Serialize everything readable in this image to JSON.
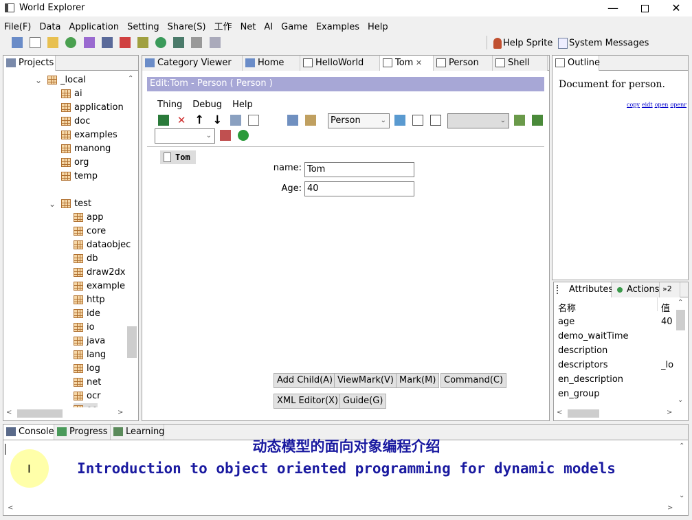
{
  "window": {
    "title": "World Explorer"
  },
  "menu": [
    "File(F)",
    "Data",
    "Application",
    "Setting",
    "Share(S)",
    "工作",
    "Net",
    "AI",
    "Game",
    "Examples",
    "Help"
  ],
  "toolbar_right": {
    "help_sprite": "Help Sprite",
    "system_messages": "System Messages"
  },
  "projects": {
    "tab": "Projects",
    "root": "_local",
    "items": [
      "ai",
      "application",
      "doc",
      "examples",
      "manong",
      "org",
      "temp"
    ],
    "test": "test",
    "test_items": [
      "app",
      "core",
      "dataobjec",
      "db",
      "draw2dx",
      "example",
      "http",
      "ide",
      "io",
      "java",
      "lang",
      "log",
      "net",
      "ocr",
      "oo"
    ]
  },
  "editor_tabs": [
    "Category Viewer",
    "Home",
    "HelloWorld",
    "Tom",
    "Person",
    "Shell"
  ],
  "editor": {
    "header": "Edit:Tom - Person ( Person )",
    "menus": [
      "Thing",
      "Debug",
      "Help"
    ],
    "combo_person": "Person",
    "node": "Tom",
    "fields": [
      {
        "label": "name:",
        "value": "Tom"
      },
      {
        "label": "Age:",
        "value": "40"
      }
    ],
    "buttons_row1": [
      "Add Child(A)",
      "ViewMark(V)",
      "Mark(M)",
      "Command(C)"
    ],
    "buttons_row2": [
      "XML Editor(X)",
      "Guide(G)"
    ]
  },
  "outline": {
    "tab": "Outline",
    "text": "Document for person.",
    "links": [
      "copy",
      "eidt",
      "open",
      "openr"
    ]
  },
  "attributes": {
    "tabs": [
      "Attributes",
      "Actions",
      "»2"
    ],
    "headers": [
      "名称",
      "值"
    ],
    "rows": [
      {
        "name": "age",
        "value": "40"
      },
      {
        "name": "demo_waitTime",
        "value": ""
      },
      {
        "name": "description",
        "value": ""
      },
      {
        "name": "descriptors",
        "value": "_loc"
      },
      {
        "name": "en_description",
        "value": ""
      },
      {
        "name": "en_group",
        "value": ""
      }
    ]
  },
  "bottom": {
    "tabs": [
      "Console",
      "Progress",
      "Learning"
    ],
    "caption_cn": "动态模型的面向对象编程介绍",
    "caption_en": "Introduction to object oriented programming for dynamic models"
  }
}
